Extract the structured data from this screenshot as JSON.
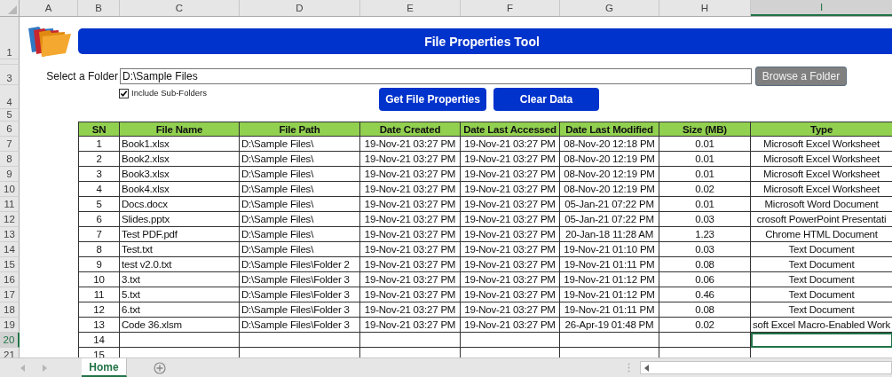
{
  "column_headers": [
    {
      "label": "A",
      "selected": false
    },
    {
      "label": "B",
      "selected": false
    },
    {
      "label": "C",
      "selected": false
    },
    {
      "label": "D",
      "selected": false
    },
    {
      "label": "E",
      "selected": false
    },
    {
      "label": "F",
      "selected": false
    },
    {
      "label": "G",
      "selected": false
    },
    {
      "label": "H",
      "selected": false
    },
    {
      "label": "I",
      "selected": true
    }
  ],
  "row_headers": [
    {
      "label": "1",
      "selected": false
    },
    {
      "label": "3",
      "selected": false
    },
    {
      "label": "4",
      "selected": false
    },
    {
      "label": "5",
      "selected": false
    },
    {
      "label": "6",
      "selected": false
    },
    {
      "label": "7",
      "selected": false
    },
    {
      "label": "8",
      "selected": false
    },
    {
      "label": "9",
      "selected": false
    },
    {
      "label": "10",
      "selected": false
    },
    {
      "label": "11",
      "selected": false
    },
    {
      "label": "12",
      "selected": false
    },
    {
      "label": "13",
      "selected": false
    },
    {
      "label": "14",
      "selected": false
    },
    {
      "label": "15",
      "selected": false
    },
    {
      "label": "16",
      "selected": false
    },
    {
      "label": "17",
      "selected": false
    },
    {
      "label": "18",
      "selected": false
    },
    {
      "label": "19",
      "selected": false
    },
    {
      "label": "20",
      "selected": true
    },
    {
      "label": "21",
      "selected": false
    }
  ],
  "title": "File Properties Tool",
  "folder": {
    "label": "Select a Folder",
    "value": "D:\\Sample Files"
  },
  "browse_button": "Browse a Folder",
  "include_subfolders": {
    "label": "Include Sub-Folders",
    "checked": true
  },
  "buttons": [
    "Get File Properties",
    "Clear Data"
  ],
  "table": {
    "columns": [
      "SN",
      "File Name",
      "File Path",
      "Date Created",
      "Date Last Accessed",
      "Date Last Modified",
      "Size (MB)",
      "Type"
    ],
    "rows": [
      [
        "1",
        "Book1.xlsx",
        "D:\\Sample Files\\",
        "19-Nov-21 03:27 PM",
        "19-Nov-21 03:27 PM",
        "08-Nov-20 12:18 PM",
        "0.01",
        "Microsoft Excel Worksheet"
      ],
      [
        "2",
        "Book2.xlsx",
        "D:\\Sample Files\\",
        "19-Nov-21 03:27 PM",
        "19-Nov-21 03:27 PM",
        "08-Nov-20 12:19 PM",
        "0.01",
        "Microsoft Excel Worksheet"
      ],
      [
        "3",
        "Book3.xlsx",
        "D:\\Sample Files\\",
        "19-Nov-21 03:27 PM",
        "19-Nov-21 03:27 PM",
        "08-Nov-20 12:19 PM",
        "0.01",
        "Microsoft Excel Worksheet"
      ],
      [
        "4",
        "Book4.xlsx",
        "D:\\Sample Files\\",
        "19-Nov-21 03:27 PM",
        "19-Nov-21 03:27 PM",
        "08-Nov-20 12:19 PM",
        "0.02",
        "Microsoft Excel Worksheet"
      ],
      [
        "5",
        "Docs.docx",
        "D:\\Sample Files\\",
        "19-Nov-21 03:27 PM",
        "19-Nov-21 03:27 PM",
        "05-Jan-21 07:22 PM",
        "0.01",
        "Microsoft Word Document"
      ],
      [
        "6",
        "Slides.pptx",
        "D:\\Sample Files\\",
        "19-Nov-21 03:27 PM",
        "19-Nov-21 03:27 PM",
        "05-Jan-21 07:22 PM",
        "0.03",
        "crosoft PowerPoint Presentati"
      ],
      [
        "7",
        "Test PDF.pdf",
        "D:\\Sample Files\\",
        "19-Nov-21 03:27 PM",
        "19-Nov-21 03:27 PM",
        "20-Jan-18 11:28 AM",
        "1.23",
        "Chrome HTML Document"
      ],
      [
        "8",
        "Test.txt",
        "D:\\Sample Files\\",
        "19-Nov-21 03:27 PM",
        "19-Nov-21 03:27 PM",
        "19-Nov-21 01:10 PM",
        "0.03",
        "Text Document"
      ],
      [
        "9",
        "test v2.0.txt",
        "D:\\Sample Files\\Folder 2",
        "19-Nov-21 03:27 PM",
        "19-Nov-21 03:27 PM",
        "19-Nov-21 01:11 PM",
        "0.08",
        "Text Document"
      ],
      [
        "10",
        "3.txt",
        "D:\\Sample Files\\Folder 3",
        "19-Nov-21 03:27 PM",
        "19-Nov-21 03:27 PM",
        "19-Nov-21 01:12 PM",
        "0.06",
        "Text Document"
      ],
      [
        "11",
        "5.txt",
        "D:\\Sample Files\\Folder 3",
        "19-Nov-21 03:27 PM",
        "19-Nov-21 03:27 PM",
        "19-Nov-21 01:12 PM",
        "0.46",
        "Text Document"
      ],
      [
        "12",
        "6.txt",
        "D:\\Sample Files\\Folder 3",
        "19-Nov-21 03:27 PM",
        "19-Nov-21 03:27 PM",
        "19-Nov-21 01:11 PM",
        "0.08",
        "Text Document"
      ],
      [
        "13",
        "Code 36.xlsm",
        "D:\\Sample Files\\Folder 3",
        "19-Nov-21 03:27 PM",
        "19-Nov-21 03:27 PM",
        "26-Apr-19 01:48 PM",
        "0.02",
        "soft Excel Macro-Enabled Work"
      ],
      [
        "14"
      ],
      [
        "15"
      ]
    ]
  },
  "sheet_tabs": [
    {
      "label": "Home",
      "selected": true
    }
  ]
}
